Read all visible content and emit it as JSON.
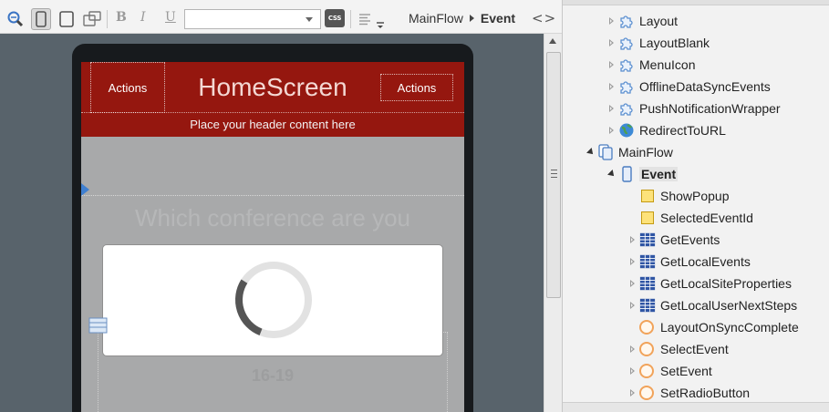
{
  "toolbar": {
    "css_label": "CSS",
    "bold": "B",
    "italic": "I",
    "underline": "U",
    "style_value": "",
    "breadcrumb": [
      "MainFlow",
      "Event"
    ],
    "code_toggle": "<>"
  },
  "screen": {
    "header": {
      "left_action": "Actions",
      "title": "HomeScreen",
      "right_action": "Actions",
      "header_content": "Place your header content here"
    },
    "ghost_title": "Which conference are you",
    "ghost_number": "16-19"
  },
  "tree": {
    "items": [
      {
        "label": "Layout",
        "icon": "puzzle-icon",
        "level": 2,
        "expander": "closed"
      },
      {
        "label": "LayoutBlank",
        "icon": "puzzle-icon",
        "level": 2,
        "expander": "closed"
      },
      {
        "label": "MenuIcon",
        "icon": "puzzle-icon",
        "level": 2,
        "expander": "closed"
      },
      {
        "label": "OfflineDataSyncEvents",
        "icon": "puzzle-icon",
        "level": 2,
        "expander": "closed"
      },
      {
        "label": "PushNotificationWrapper",
        "icon": "puzzle-icon",
        "level": 2,
        "expander": "closed"
      },
      {
        "label": "RedirectToURL",
        "icon": "globe-icon",
        "level": 2,
        "expander": "closed"
      },
      {
        "label": "MainFlow",
        "icon": "flow-icon",
        "level": 1,
        "expander": "open"
      },
      {
        "label": "Event",
        "icon": "mobile-screen-icon",
        "level": 2,
        "expander": "open",
        "selected": true
      },
      {
        "label": "ShowPopup",
        "icon": "variable-icon",
        "level": 3,
        "expander": "none"
      },
      {
        "label": "SelectedEventId",
        "icon": "variable-icon",
        "level": 3,
        "expander": "none"
      },
      {
        "label": "GetEvents",
        "icon": "aggregate-icon",
        "level": 3,
        "expander": "closed"
      },
      {
        "label": "GetLocalEvents",
        "icon": "aggregate-icon",
        "level": 3,
        "expander": "closed"
      },
      {
        "label": "GetLocalSiteProperties",
        "icon": "aggregate-icon",
        "level": 3,
        "expander": "closed"
      },
      {
        "label": "GetLocalUserNextSteps",
        "icon": "aggregate-icon",
        "level": 3,
        "expander": "closed"
      },
      {
        "label": "LayoutOnSyncComplete",
        "icon": "action-icon",
        "level": 3,
        "expander": "none"
      },
      {
        "label": "SelectEvent",
        "icon": "action-icon",
        "level": 3,
        "expander": "closed"
      },
      {
        "label": "SetEvent",
        "icon": "action-icon",
        "level": 3,
        "expander": "closed"
      },
      {
        "label": "SetRadioButton",
        "icon": "action-icon",
        "level": 3,
        "expander": "closed"
      }
    ]
  },
  "colors": {
    "header_red": "#95170f",
    "canvas_bg": "#58636b",
    "screen_bg": "#a8a9aa",
    "accent_blue": "#3f7fd0",
    "variable_yellow": "#fde27a",
    "action_orange": "#f1a35a",
    "aggregate_blue": "#2f55a4"
  },
  "loader_progress": 0.28
}
